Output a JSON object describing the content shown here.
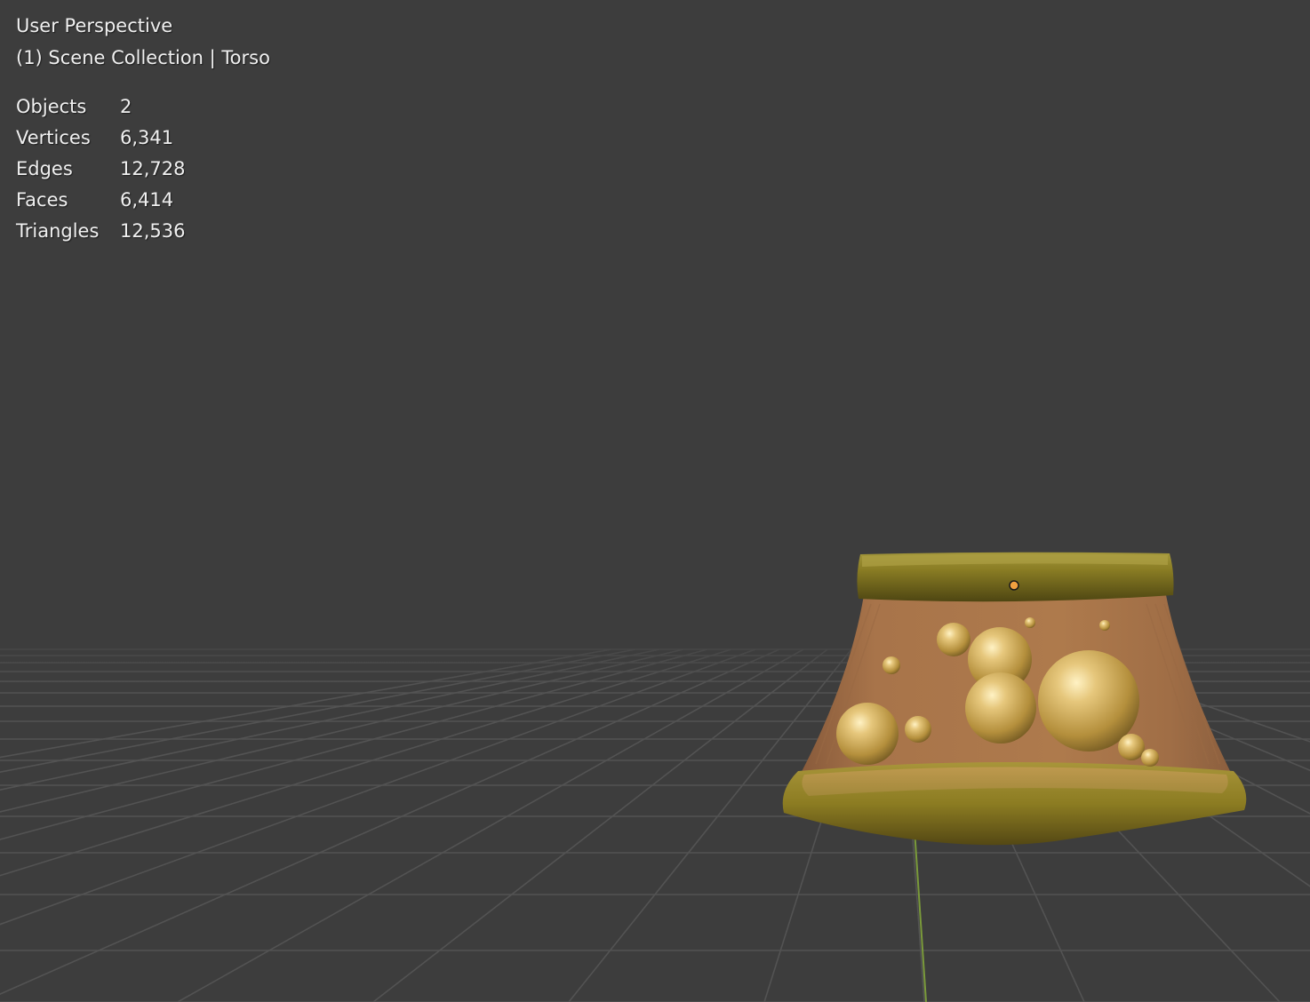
{
  "viewport": {
    "view_name": "User Perspective",
    "collection_line": "(1) Scene Collection | Torso",
    "background_color": "#3d3d3d",
    "grid_color": "#545454",
    "y_axis_color": "#7a9a3a",
    "origin_dot_color": "#f0a040"
  },
  "stats": [
    {
      "label": "Objects",
      "value": "2"
    },
    {
      "label": "Vertices",
      "value": "6,341"
    },
    {
      "label": "Edges",
      "value": "12,728"
    },
    {
      "label": "Faces",
      "value": "6,414"
    },
    {
      "label": "Triangles",
      "value": "12,536"
    }
  ],
  "object": {
    "name": "Torso",
    "body_color": "#a8744a",
    "band_color": "#8a7a20",
    "sphere_color": "#d8b35a"
  }
}
